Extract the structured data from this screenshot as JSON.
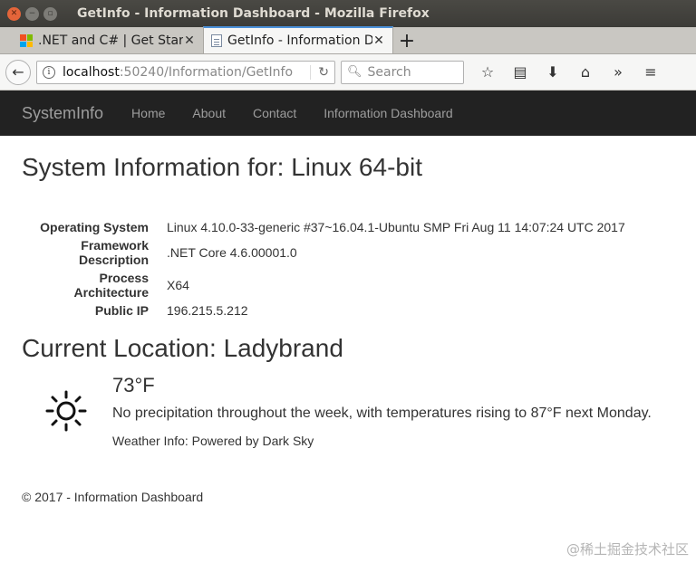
{
  "window": {
    "title": "GetInfo - Information Dashboard - Mozilla Firefox"
  },
  "tabs": [
    {
      "label": ".NET and C# | Get Started",
      "active": false
    },
    {
      "label": "GetInfo - Information Dashboard",
      "active": true
    }
  ],
  "navbar": {
    "url_host": "localhost",
    "url_rest": ":50240/Information/GetInfo",
    "search_placeholder": "Search"
  },
  "site": {
    "brand": "SystemInfo",
    "nav": [
      "Home",
      "About",
      "Contact",
      "Information Dashboard"
    ]
  },
  "page": {
    "title": "System Information for: Linux 64-bit",
    "info": [
      {
        "key": "Operating System",
        "value": "Linux 4.10.0-33-generic #37~16.04.1-Ubuntu SMP Fri Aug 11 14:07:24 UTC 2017"
      },
      {
        "key": "Framework Description",
        "value": ".NET Core 4.6.00001.0"
      },
      {
        "key": "Process Architecture",
        "value": "X64"
      },
      {
        "key": "Public IP",
        "value": "196.215.5.212"
      }
    ],
    "location_title": "Current Location: Ladybrand",
    "weather": {
      "icon": "sun-icon",
      "temperature": "73°F",
      "summary": "No precipitation throughout the week, with temperatures rising to 87°F next Monday.",
      "powered_by": "Weather Info: Powered by Dark Sky"
    },
    "footer": "© 2017 - Information Dashboard"
  },
  "watermark": "@稀土掘金技术社区"
}
